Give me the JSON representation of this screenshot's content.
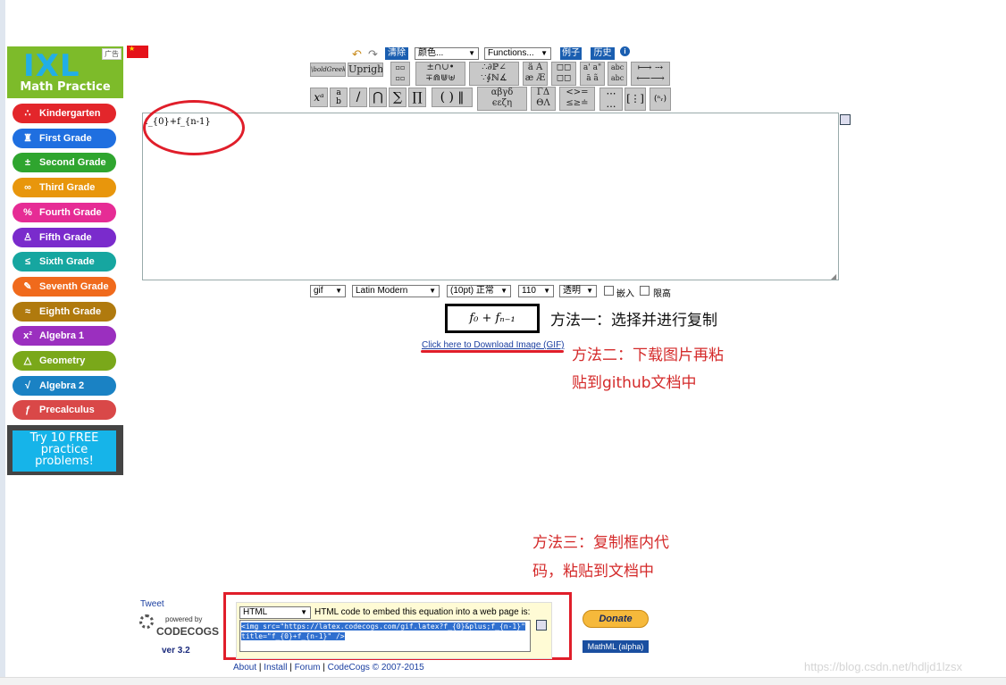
{
  "ad": {
    "tag": "广告",
    "logo": "IXL",
    "subtitle": "Math Practice",
    "items": [
      {
        "label": "Kindergarten",
        "icon": "∴",
        "color": "#e3262b"
      },
      {
        "label": "First Grade",
        "icon": "♜",
        "color": "#1f6fe0"
      },
      {
        "label": "Second Grade",
        "icon": "±",
        "color": "#2fa52f"
      },
      {
        "label": "Third Grade",
        "icon": "∞",
        "color": "#e8960c"
      },
      {
        "label": "Fourth Grade",
        "icon": "%",
        "color": "#e62c95"
      },
      {
        "label": "Fifth Grade",
        "icon": "♙",
        "color": "#7a2bcc"
      },
      {
        "label": "Sixth Grade",
        "icon": "≤",
        "color": "#16a6a0"
      },
      {
        "label": "Seventh Grade",
        "icon": "✎",
        "color": "#f06a1c"
      },
      {
        "label": "Eighth Grade",
        "icon": "≈",
        "color": "#b07a0e"
      },
      {
        "label": "Algebra 1",
        "icon": "x²",
        "color": "#9b2fbf"
      },
      {
        "label": "Geometry",
        "icon": "△",
        "color": "#7aa81a"
      },
      {
        "label": "Algebra 2",
        "icon": "√",
        "color": "#1a82c4"
      },
      {
        "label": "Precalculus",
        "icon": "ƒ",
        "color": "#d94848"
      }
    ],
    "cta_line1": "Try 10 FREE",
    "cta_line2": "practice",
    "cta_line3": "problems!"
  },
  "toolbar": {
    "clear": "清除",
    "color_select": "颜色...",
    "functions_select": "Functions...",
    "examples": "例子",
    "history": "历史",
    "bold_greek": "\\boldGreek",
    "upright": "Upright"
  },
  "editor": {
    "content": "f_{0}+f_{n-1}"
  },
  "options": {
    "format": "gif",
    "font": "Latin Modern",
    "size": "(10pt) 正常",
    "dpi": "110",
    "background": "透明",
    "embed_label": "嵌入",
    "inline_label": "限高"
  },
  "preview": {
    "rendered": "f₀ + fₙ₋₁"
  },
  "annotations": {
    "method1": "方法一：选择并进行复制",
    "method2_line1": "方法二：下载图片再粘",
    "method2_line2": "贴到github文档中",
    "method3_line1": "方法三：复制框内代",
    "method3_line2": "码，粘贴到文档中"
  },
  "download_link": "Click here to Download Image (GIF)",
  "embed": {
    "type_select": "HTML",
    "description": "HTML code to embed this equation into a web page is:",
    "code_line1": "<img src=\"https://latex.codecogs.com/gif.latex?f_{0}&plus;f_{n-1}\"",
    "code_line2": "title=\"f_{0}+f_{n-1}\" />"
  },
  "left_footer": {
    "tweet": "Tweet",
    "powered_by": "powered by",
    "brand": "CODECOGS",
    "version": "ver 3.2"
  },
  "donate": "Donate",
  "mathml": "MathML (alpha)",
  "footer": {
    "about": "About",
    "install": "Install",
    "forum": "Forum",
    "copyright": "CodeCogs © 2007-2015"
  },
  "watermark": "https://blog.csdn.net/hdljd1lzsx"
}
